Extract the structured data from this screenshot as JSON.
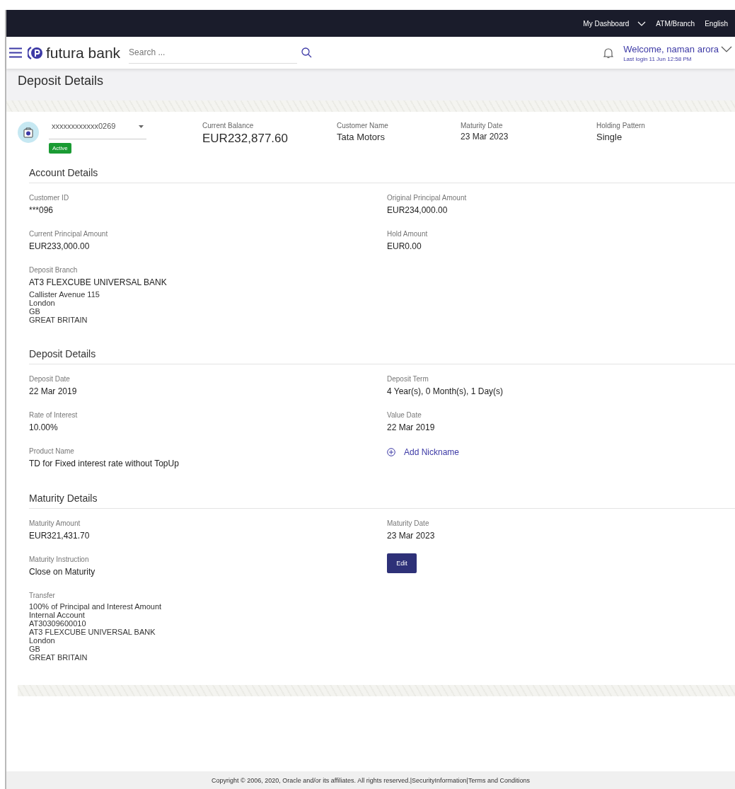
{
  "top_bar": {
    "items": [
      {
        "label": "My Dashboard",
        "kind": "dropdown"
      },
      {
        "label": "ATM/Branch",
        "kind": "link"
      },
      {
        "label": "English",
        "kind": "link"
      }
    ]
  },
  "header": {
    "brand": "futura bank",
    "search": {
      "placeholder": "Search ..."
    },
    "welcome": "Welcome, naman arora",
    "last_login": "Last login 11 Jun 12:58 PM"
  },
  "page_title": "Deposit Details",
  "summary": {
    "account": "xxxxxxxxxxxx0269",
    "status": "Active",
    "fields": [
      {
        "label": "Current Balance",
        "value": "EUR232,877.60",
        "kind": "large"
      },
      {
        "label": "Customer Name",
        "value": "Tata Motors",
        "kind": "normal"
      },
      {
        "label": "Maturity Date",
        "value": "23 Mar 2023",
        "kind": "small"
      },
      {
        "label": "Holding Pattern",
        "value": "Single",
        "kind": "normal"
      }
    ]
  },
  "sections": [
    {
      "title": "Account Details",
      "left": [
        {
          "kind": "field",
          "label": "Customer ID",
          "value": "***096"
        },
        {
          "kind": "field",
          "label": "Current Principal Amount",
          "value": "EUR233,000.00"
        },
        {
          "kind": "field",
          "label": "Deposit Branch",
          "value": "AT3 FLEXCUBE UNIVERSAL BANK",
          "lines": [
            "Callister Avenue 115",
            "London",
            "GB",
            "GREAT BRITAIN"
          ]
        }
      ],
      "right": [
        {
          "kind": "field",
          "label": "Original Principal Amount",
          "value": "EUR234,000.00"
        },
        {
          "kind": "field",
          "label": "Hold Amount",
          "value": "EUR0.00"
        }
      ]
    },
    {
      "title": "Deposit Details",
      "left": [
        {
          "kind": "field",
          "label": "Deposit Date",
          "value": "22 Mar 2019"
        },
        {
          "kind": "field",
          "label": "Rate of Interest",
          "value": "10.00%"
        },
        {
          "kind": "field",
          "label": "Product Name",
          "value": "TD for Fixed interest rate without TopUp"
        }
      ],
      "right": [
        {
          "kind": "field",
          "label": "Deposit Term",
          "value": "4 Year(s), 0 Month(s), 1 Day(s)"
        },
        {
          "kind": "field",
          "label": "Value Date",
          "value": "22 Mar 2019"
        },
        {
          "kind": "link",
          "label": "Add Nickname"
        }
      ]
    },
    {
      "title": "Maturity Details",
      "left": [
        {
          "kind": "field",
          "label": "Maturity Amount",
          "value": "EUR321,431.70"
        },
        {
          "kind": "field",
          "label": "Maturity Instruction",
          "value": "Close on Maturity"
        },
        {
          "kind": "field",
          "label": "Transfer",
          "lines": [
            "100% of Principal and Interest Amount",
            "Internal Account",
            "AT30309600010",
            "AT3 FLEXCUBE UNIVERSAL BANK",
            "London",
            "GB",
            "GREAT BRITAIN"
          ]
        }
      ],
      "right": [
        {
          "kind": "field",
          "label": "Maturity Date",
          "value": "23 Mar 2023"
        },
        {
          "kind": "button",
          "label": "Edit"
        }
      ]
    }
  ],
  "footer": {
    "copyright": "Copyright © 2006, 2020, Oracle and/or its affiliates. All rights reserved.",
    "links": [
      {
        "separator": "|",
        "label": "SecurityInformation"
      },
      {
        "separator": "|",
        "label": "Terms and Conditions"
      }
    ]
  }
}
